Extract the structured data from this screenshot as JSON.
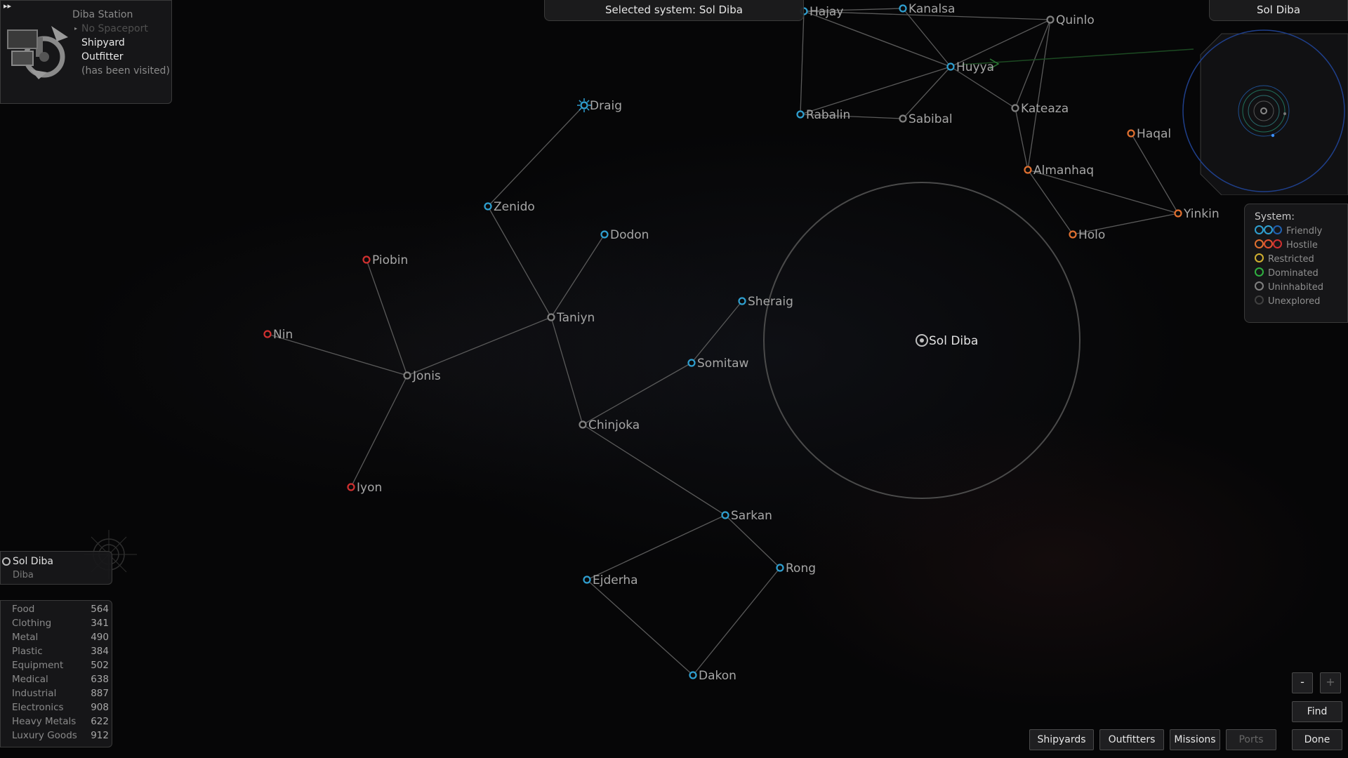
{
  "title_bar": {
    "text": "Selected system: Sol Diba"
  },
  "planet_panel": {
    "name": "Diba Station",
    "spaceport": "No Spaceport",
    "services": [
      "Shipyard",
      "Outfitter"
    ],
    "visited": "(has been visited)",
    "fast_forward": "▸▸"
  },
  "mini_map": {
    "title": "Sol Diba"
  },
  "legend": {
    "title": "System:",
    "items": [
      {
        "label": "Friendly",
        "colors": [
          "#2f9fd0",
          "#2f9fd0",
          "#2060b0"
        ]
      },
      {
        "label": "Hostile",
        "colors": [
          "#e07030",
          "#e05030",
          "#d03030"
        ]
      },
      {
        "label": "Restricted",
        "colors": [
          "#d0b030"
        ]
      },
      {
        "label": "Dominated",
        "colors": [
          "#30b040"
        ]
      },
      {
        "label": "Uninhabited",
        "colors": [
          "#808080"
        ]
      },
      {
        "label": "Unexplored",
        "colors": [
          "#404040"
        ]
      }
    ]
  },
  "system_panel": {
    "name": "Sol Diba",
    "government": "Diba"
  },
  "trade": [
    {
      "name": "Food",
      "price": "564"
    },
    {
      "name": "Clothing",
      "price": "341"
    },
    {
      "name": "Metal",
      "price": "490"
    },
    {
      "name": "Plastic",
      "price": "384"
    },
    {
      "name": "Equipment",
      "price": "502"
    },
    {
      "name": "Medical",
      "price": "638"
    },
    {
      "name": "Industrial",
      "price": "887"
    },
    {
      "name": "Electronics",
      "price": "908"
    },
    {
      "name": "Heavy Metals",
      "price": "622"
    },
    {
      "name": "Luxury Goods",
      "price": "912"
    }
  ],
  "buttons": {
    "zoom_out": "-",
    "zoom_in": "+",
    "find": "Find",
    "shipyards": "Shipyards",
    "outfitters": "Outfitters",
    "missions": "Missions",
    "ports": "Ports",
    "done": "Done"
  },
  "colors": {
    "friendly": "#2f9fd0",
    "hostile": "#e07030",
    "hostile_red": "#d03030",
    "uninhabited": "#808080",
    "link": "#5a5a5a"
  },
  "systems": [
    {
      "name": "Hajay",
      "type": "friendly"
    },
    {
      "name": "Kanalsa",
      "type": "friendly"
    },
    {
      "name": "Quinlo",
      "type": "uninhabited"
    },
    {
      "name": "Huyya",
      "type": "friendly"
    },
    {
      "name": "Rabalin",
      "type": "friendly"
    },
    {
      "name": "Sabibal",
      "type": "uninhabited"
    },
    {
      "name": "Kateaza",
      "type": "uninhabited"
    },
    {
      "name": "Haqal",
      "type": "hostile"
    },
    {
      "name": "Almanhaq",
      "type": "hostile"
    },
    {
      "name": "Yinkin",
      "type": "hostile"
    },
    {
      "name": "Holo",
      "type": "hostile"
    },
    {
      "name": "Draig",
      "type": "friendly"
    },
    {
      "name": "Zenido",
      "type": "friendly"
    },
    {
      "name": "Dodon",
      "type": "friendly"
    },
    {
      "name": "Piobin",
      "type": "hostile_red"
    },
    {
      "name": "Nin",
      "type": "hostile_red"
    },
    {
      "name": "Taniyn",
      "type": "uninhabited"
    },
    {
      "name": "Jonis",
      "type": "uninhabited"
    },
    {
      "name": "Sheraig",
      "type": "friendly"
    },
    {
      "name": "Somitaw",
      "type": "friendly"
    },
    {
      "name": "Chinjoka",
      "type": "uninhabited"
    },
    {
      "name": "Iyon",
      "type": "hostile_red"
    },
    {
      "name": "Sarkan",
      "type": "friendly"
    },
    {
      "name": "Ejderha",
      "type": "friendly"
    },
    {
      "name": "Rong",
      "type": "friendly"
    },
    {
      "name": "Dakon",
      "type": "friendly"
    },
    {
      "name": "Sol Diba",
      "type": "selected"
    }
  ],
  "links": [
    [
      "Hajay",
      "Kanalsa"
    ],
    [
      "Hajay",
      "Quinlo"
    ],
    [
      "Hajay",
      "Huyya"
    ],
    [
      "Hajay",
      "Rabalin"
    ],
    [
      "Kanalsa",
      "Huyya"
    ],
    [
      "Quinlo",
      "Huyya"
    ],
    [
      "Quinlo",
      "Kateaza"
    ],
    [
      "Quinlo",
      "Almanhaq"
    ],
    [
      "Huyya",
      "Rabalin"
    ],
    [
      "Huyya",
      "Sabibal"
    ],
    [
      "Huyya",
      "Kateaza"
    ],
    [
      "Rabalin",
      "Sabibal"
    ],
    [
      "Kateaza",
      "Almanhaq"
    ],
    [
      "Almanhaq",
      "Yinkin"
    ],
    [
      "Almanhaq",
      "Holo"
    ],
    [
      "Haqal",
      "Yinkin"
    ],
    [
      "Holo",
      "Yinkin"
    ],
    [
      "Draig",
      "Zenido"
    ],
    [
      "Zenido",
      "Taniyn"
    ],
    [
      "Dodon",
      "Taniyn"
    ],
    [
      "Taniyn",
      "Jonis"
    ],
    [
      "Taniyn",
      "Chinjoka"
    ],
    [
      "Piobin",
      "Jonis"
    ],
    [
      "Nin",
      "Jonis"
    ],
    [
      "Jonis",
      "Iyon"
    ],
    [
      "Sheraig",
      "Somitaw"
    ],
    [
      "Somitaw",
      "Chinjoka"
    ],
    [
      "Chinjoka",
      "Sarkan"
    ],
    [
      "Sarkan",
      "Ejderha"
    ],
    [
      "Sarkan",
      "Rong"
    ],
    [
      "Ejderha",
      "Dakon"
    ],
    [
      "Rong",
      "Dakon"
    ]
  ]
}
